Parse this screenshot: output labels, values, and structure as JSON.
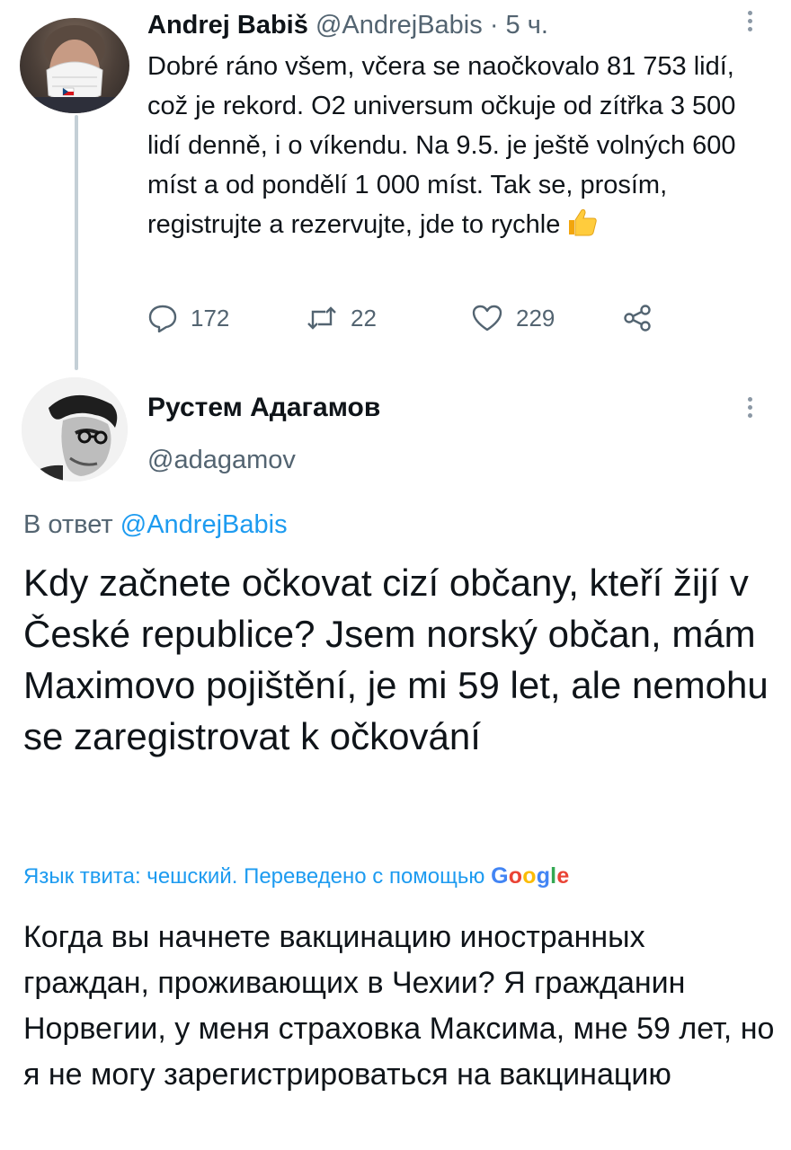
{
  "parent_tweet": {
    "author_name": "Andrej Babiš",
    "author_handle": "@AndrejBabis",
    "separator": "·",
    "timestamp": "5 ч.",
    "text": "Dobré ráno všem, včera se naočkovalo 81 753 lidí, což je rekord. O2 universum očkuje od zítřka 3 500 lidí denně, i o víkendu. Na 9.5. je ještě volných 600 míst a od pondělí 1 000 míst. Tak se, prosím, registrujte a rezervujte, jde to rychle",
    "emoji_icon": "thumbs-up-icon",
    "reply_count": "172",
    "retweet_count": "22",
    "like_count": "229"
  },
  "reply_tweet": {
    "author_name": "Рустем Адагамов",
    "author_handle": "@adagamov",
    "reply_to_prefix": "В ответ",
    "reply_to_handle": "@AndrejBabis",
    "text": "Kdy začnete očkovat cizí občany, kteří žijí v České republice? Jsem norský občan, mám Maximovo pojištění, je mi 59 let, ale nemohu se zaregistrovat k očkování",
    "translation_note": "Язык твита: чешский. Переведено с помощью",
    "translation_provider": {
      "g1": "G",
      "o1": "o",
      "o2": "o",
      "g2": "g",
      "l": "l",
      "e": "e"
    },
    "translated_text": "Когда вы начнете вакцинацию иностранных граждан, проживающих в Чехии? Я гражданин Норвегии, у меня страховка Максима, мне 59 лет, но я не могу зарегистрироваться на вакцинацию"
  },
  "colors": {
    "link": "#1d9bf0",
    "secondary_text": "#536471",
    "primary_text": "#0f1419",
    "thread_line": "#c4cfd6"
  },
  "icons": [
    "reply-icon",
    "retweet-icon",
    "like-icon",
    "share-icon",
    "more-options-icon",
    "thumbs-up-icon"
  ]
}
